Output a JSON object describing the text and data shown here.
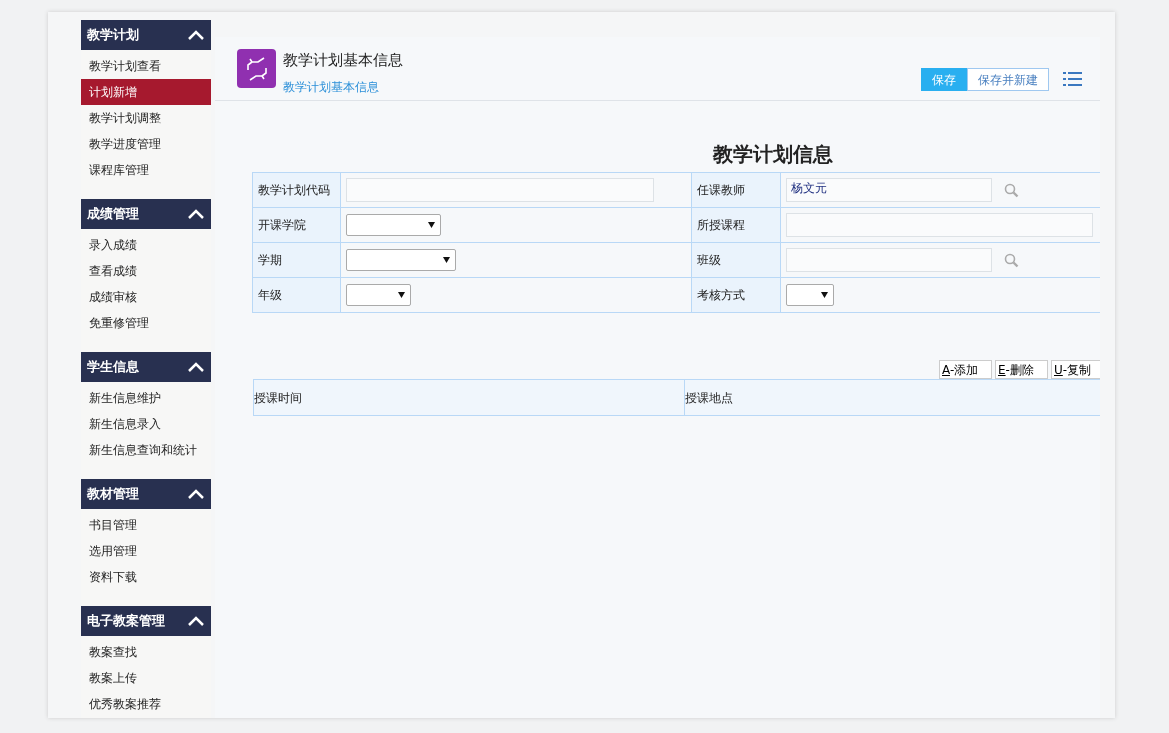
{
  "sidebar": {
    "sections": [
      {
        "title": "教学计划",
        "expanded": true,
        "items": [
          {
            "label": "教学计划查看",
            "selected": false
          },
          {
            "label": "计划新增",
            "selected": true
          },
          {
            "label": "教学计划调整",
            "selected": false
          },
          {
            "label": "教学进度管理",
            "selected": false
          },
          {
            "label": "课程库管理",
            "selected": false
          }
        ]
      },
      {
        "title": "成绩管理",
        "expanded": true,
        "items": [
          {
            "label": "录入成绩",
            "selected": false
          },
          {
            "label": "查看成绩",
            "selected": false
          },
          {
            "label": "成绩审核",
            "selected": false
          },
          {
            "label": "免重修管理",
            "selected": false
          }
        ]
      },
      {
        "title": "学生信息",
        "expanded": true,
        "items": [
          {
            "label": "新生信息维护",
            "selected": false
          },
          {
            "label": "新生信息录入",
            "selected": false
          },
          {
            "label": "新生信息查询和统计",
            "selected": false
          }
        ]
      },
      {
        "title": "教材管理",
        "expanded": true,
        "items": [
          {
            "label": "书目管理",
            "selected": false
          },
          {
            "label": "选用管理",
            "selected": false
          },
          {
            "label": "资料下载",
            "selected": false
          }
        ]
      },
      {
        "title": "电子教案管理",
        "expanded": true,
        "items": [
          {
            "label": "教案查找",
            "selected": false
          },
          {
            "label": "教案上传",
            "selected": false
          },
          {
            "label": "优秀教案推荐",
            "selected": false
          }
        ]
      }
    ]
  },
  "header": {
    "title": "教学计划基本信息",
    "tab": "教学计划基本信息",
    "buttons": [
      {
        "label": "保存",
        "primary": true
      },
      {
        "label": "保存并新建",
        "primary": false
      }
    ]
  },
  "form": {
    "title": "教学计划信息",
    "rows": [
      [
        {
          "label": "教学计划代码",
          "kind": "text"
        },
        {
          "label": "任课教师",
          "kind": "lookup",
          "value": "杨文元"
        }
      ],
      [
        {
          "label": "开课学院",
          "kind": "select"
        },
        {
          "label": "所授课程",
          "kind": "text"
        }
      ],
      [
        {
          "label": "学期",
          "kind": "select"
        },
        {
          "label": "班级",
          "kind": "lookup"
        }
      ],
      [
        {
          "label": "年级",
          "kind": "select"
        },
        {
          "label": "考核方式",
          "kind": "select"
        }
      ]
    ]
  },
  "grid": {
    "buttons": [
      {
        "key": "A",
        "label": "-添加"
      },
      {
        "key": "E",
        "label": "-删除"
      },
      {
        "key": "U",
        "label": "-复制"
      }
    ],
    "columns": [
      "授课时间",
      "授课地点"
    ]
  }
}
